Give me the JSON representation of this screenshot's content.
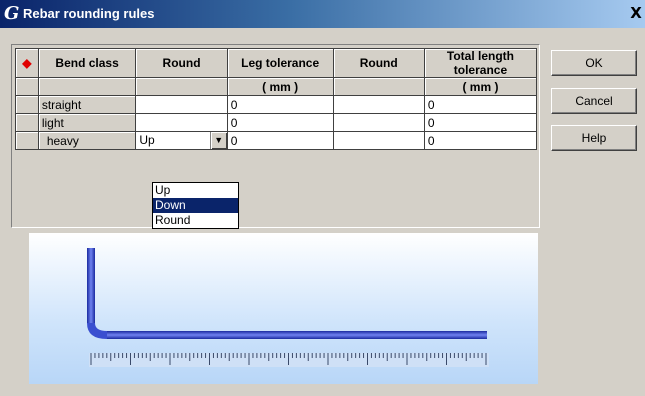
{
  "window": {
    "title": "Rebar rounding rules",
    "logo": "G",
    "close": "X"
  },
  "grid": {
    "headers": [
      "◆",
      "Bend class",
      "Round",
      "Leg tolerance",
      "Round",
      "Total length tolerance"
    ],
    "units": [
      "",
      "",
      "",
      "( mm )",
      "",
      "( mm )"
    ],
    "rows": [
      {
        "bend_class": "straight",
        "round1": "",
        "leg_tolerance": "0",
        "round2": "",
        "total_tolerance": "0"
      },
      {
        "bend_class": "light",
        "round1": "",
        "leg_tolerance": "0",
        "round2": "",
        "total_tolerance": "0"
      },
      {
        "bend_class": "heavy",
        "round1": "Up",
        "leg_tolerance": "0",
        "round2": "",
        "total_tolerance": "0"
      }
    ]
  },
  "dropdown": {
    "options": [
      "Up",
      "Down",
      "Round"
    ],
    "selected": "Down"
  },
  "buttons": {
    "ok": "OK",
    "cancel": "Cancel",
    "help": "Help"
  },
  "colors": {
    "title_start": "#0a246a",
    "selection": "#0a246a",
    "marker": "#e00000",
    "rebar": "#3a4fd0"
  }
}
